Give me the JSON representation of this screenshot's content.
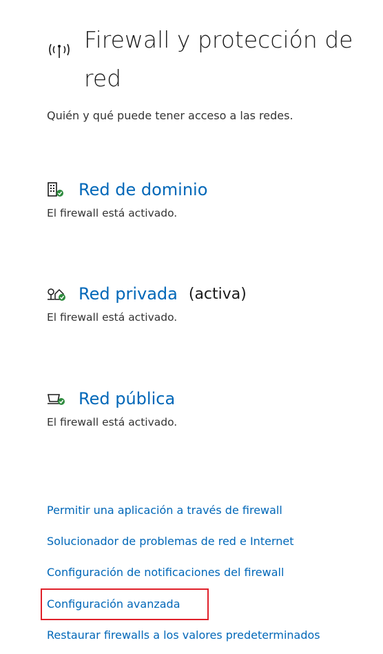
{
  "header": {
    "title": "Firewall y protección de red",
    "icon": "wifi-antenna-icon"
  },
  "subtitle": "Quién y qué puede tener acceso a las redes.",
  "networks": [
    {
      "name": "Red de dominio",
      "tag": "",
      "status": "El firewall está activado.",
      "icon": "domain-building-icon"
    },
    {
      "name": "Red privada",
      "tag": "(activa)",
      "status": "El firewall está activado.",
      "icon": "private-home-network-icon"
    },
    {
      "name": "Red pública",
      "tag": "",
      "status": "El firewall está activado.",
      "icon": "public-cafe-network-icon"
    }
  ],
  "links": [
    "Permitir una aplicación a través de firewall",
    "Solucionador de problemas de red e Internet",
    "Configuración de notificaciones del firewall",
    "Configuración avanzada",
    "Restaurar firewalls a los valores predeterminados"
  ],
  "colors": {
    "link": "#0067b8",
    "highlight_border": "#e0202a",
    "status_ok": "#2e8b3e"
  }
}
